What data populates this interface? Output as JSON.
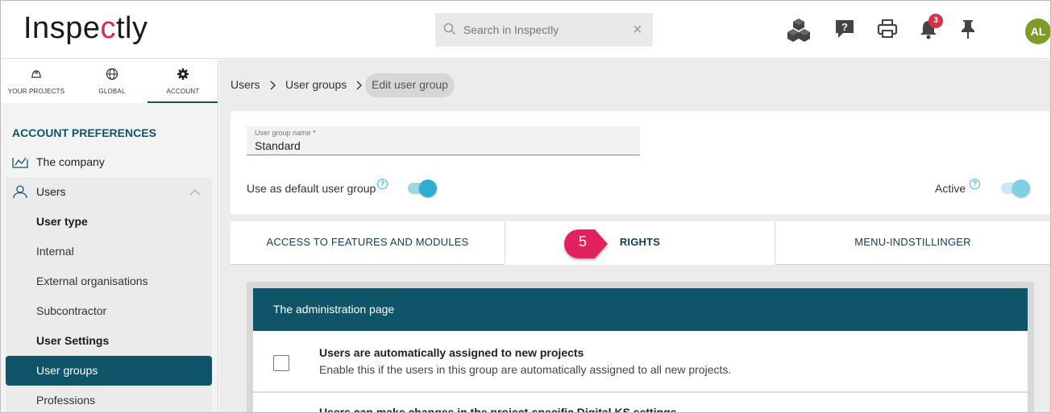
{
  "header": {
    "logo_prefix": "Inspe",
    "logo_accent": "c",
    "logo_suffix": "tly",
    "search_placeholder": "Search in Inspectly",
    "notification_count": "3",
    "avatar_initials": "AL",
    "icons": [
      "cubes-icon",
      "help-bubble-icon",
      "printer-icon",
      "bell-icon",
      "pin-icon"
    ]
  },
  "sidebar": {
    "tabs": [
      {
        "label": "YOUR PROJECTS",
        "icon": "hardhat-icon"
      },
      {
        "label": "GLOBAL",
        "icon": "globe-icon"
      },
      {
        "label": "ACCOUNT",
        "icon": "gear-icon"
      }
    ],
    "section_title": "ACCOUNT PREFERENCES",
    "company_label": "The company",
    "users_label": "Users",
    "sub_items": [
      "User type",
      "Internal",
      "External organisations",
      "Subcontractor",
      "User Settings",
      "User groups",
      "Professions"
    ]
  },
  "breadcrumb": {
    "items": [
      "Users",
      "User groups"
    ],
    "current": "Edit user group"
  },
  "form": {
    "name_label": "User group name",
    "name_value": "Standard",
    "default_label": "Use as default user group",
    "active_label": "Active"
  },
  "tabs": {
    "items": [
      "ACCESS TO FEATURES AND MODULES",
      "RIGHTS",
      "MENU-INDSTILLINGER"
    ],
    "active": "RIGHTS",
    "callout_number": "5"
  },
  "panel": {
    "title": "The administration page",
    "rows": [
      {
        "title": "Users are automatically assigned to new projects",
        "description": "Enable this if the users in this group are automatically assigned to all new projects."
      },
      {
        "title": "Users can make changes in the project-specific Digital KS settings",
        "description": ""
      }
    ]
  },
  "colors": {
    "brand": "#0f5468",
    "accent": "#e0245e",
    "badge": "#d9314c",
    "toggle": "#2eaecf",
    "avatar": "#7e9b2c"
  }
}
